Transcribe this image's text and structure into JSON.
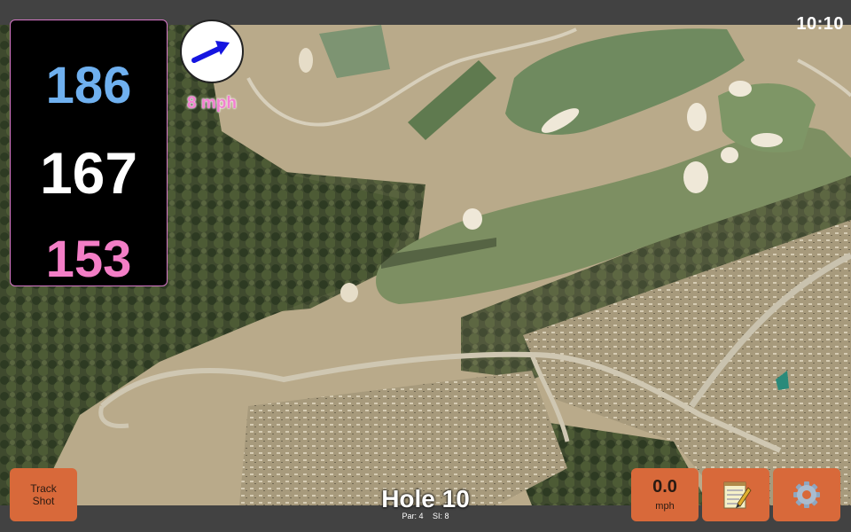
{
  "status_bar": {
    "time": "10:10"
  },
  "distances": {
    "back": "186",
    "center": "167",
    "front": "153"
  },
  "wind": {
    "speed": "8 mph",
    "icon": "wind-arrow-icon"
  },
  "buttons": {
    "track_shot_line1": "Track",
    "track_shot_line2": "Shot",
    "speed_value": "0.0",
    "speed_unit": "mph",
    "notes_icon": "notepad-icon",
    "settings_icon": "gear-icon"
  },
  "hole": {
    "title": "Hole 10",
    "par": "Par: 4",
    "si": "SI: 8"
  },
  "colors": {
    "back_distance": "#6fb0ef",
    "center_distance": "#ffffff",
    "front_distance": "#f37ec6",
    "button": "#d8693a"
  }
}
